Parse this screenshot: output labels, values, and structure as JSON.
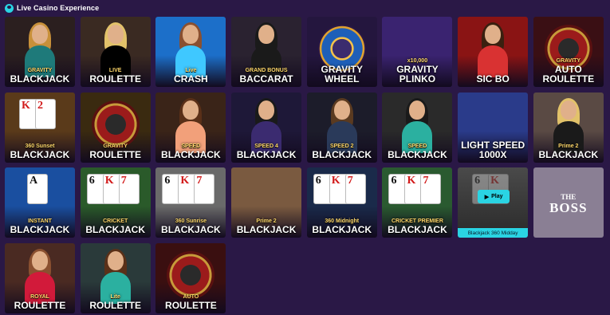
{
  "header": {
    "title": "Live Casino Experience",
    "icon": "user-icon"
  },
  "tiles": [
    {
      "label": "BLACKJACK",
      "sup": "GRAVITY",
      "bg": "#2b1f1f",
      "accent": "#1e7a7a"
    },
    {
      "label": "ROULETTE",
      "sup": "LIVE",
      "bg": "#3a2a22",
      "accent": "#000000"
    },
    {
      "label": "CRASH",
      "sup": "Live",
      "bg": "#1c6fc9",
      "accent": "#3fc8ff"
    },
    {
      "label": "BACCARAT",
      "sup": "GRAND BONUS",
      "bg": "#2a2230",
      "accent": "#1a1a1a"
    },
    {
      "label": "GRAVITY WHEEL",
      "sup": "",
      "bg": "#24163e",
      "accent": "#e0a12f"
    },
    {
      "label": "GRAVITY PLINKO",
      "sup": "x10,000",
      "bg": "#3a2370",
      "accent": "#6a3bd8"
    },
    {
      "label": "SIC BO",
      "sup": "",
      "bg": "#8a1414",
      "accent": "#d93232"
    },
    {
      "label": "AUTO ROULETTE",
      "sup": "GRAVITY",
      "bg": "#3a0f14",
      "accent": "#9b1b1b"
    },
    {
      "label": "BLACKJACK",
      "sup": "360 Sunset",
      "bg": "#5a3a1a",
      "accent": "#ffffff"
    },
    {
      "label": "ROULETTE",
      "sup": "GRAVITY",
      "bg": "#3a2a10",
      "accent": "#c79a3a"
    },
    {
      "label": "BLACKJACK",
      "sup": "SPEED",
      "bg": "#3a2418",
      "accent": "#f2a07a"
    },
    {
      "label": "BLACKJACK",
      "sup": "SPEED 4",
      "bg": "#1e1838",
      "accent": "#3b2b70"
    },
    {
      "label": "BLACKJACK",
      "sup": "SPEED 2",
      "bg": "#1c1c2a",
      "accent": "#2a3a5a"
    },
    {
      "label": "BLACKJACK",
      "sup": "SPEED",
      "bg": "#2a2a2a",
      "accent": "#2bb0a0"
    },
    {
      "label": "LIGHT SPEED 1000X",
      "sup": "",
      "bg": "#2a3b8a",
      "accent": "#c74bd8"
    },
    {
      "label": "BLACKJACK",
      "sup": "Prime 2",
      "bg": "#5a4a44",
      "accent": "#1a1a1a"
    },
    {
      "label": "BLACKJACK",
      "sup": "INSTANT",
      "bg": "#1a4fa0",
      "accent": "#ffffff"
    },
    {
      "label": "BLACKJACK",
      "sup": "CRICKET",
      "bg": "#2a5a2a",
      "accent": "#ffffff"
    },
    {
      "label": "BLACKJACK",
      "sup": "360 Sunrise",
      "bg": "#6a6a6a",
      "accent": "#ffffff"
    },
    {
      "label": "BLACKJACK",
      "sup": "Prime 2",
      "bg": "#7a5a40",
      "accent": "#4a3020"
    },
    {
      "label": "BLACKJACK",
      "sup": "360 Midnight",
      "bg": "#1a2a4a",
      "accent": "#ffffff"
    },
    {
      "label": "BLACKJACK",
      "sup": "CRICKET PREMIER",
      "bg": "#2a5a30",
      "accent": "#ffffff"
    },
    {
      "label": "",
      "sup": "",
      "bg": "#3d3d3d",
      "accent": "#2ad4e3",
      "play": "Play",
      "caption": "Blackjack 360 Midday"
    },
    {
      "label": "",
      "sup": "",
      "bg": "#8a7f94",
      "accent": "#ffffff",
      "boss_small": "THE",
      "boss_big": "BOSS"
    },
    {
      "label": "ROULETTE",
      "sup": "ROYAL",
      "bg": "#4a2a22",
      "accent": "#d21a3a"
    },
    {
      "label": "ROULETTE",
      "sup": "Lite",
      "bg": "#2a3a3a",
      "accent": "#2bb0a0"
    },
    {
      "label": "ROULETTE",
      "sup": "AUTO",
      "bg": "#3a0f10",
      "accent": "#9b1b1b"
    }
  ]
}
